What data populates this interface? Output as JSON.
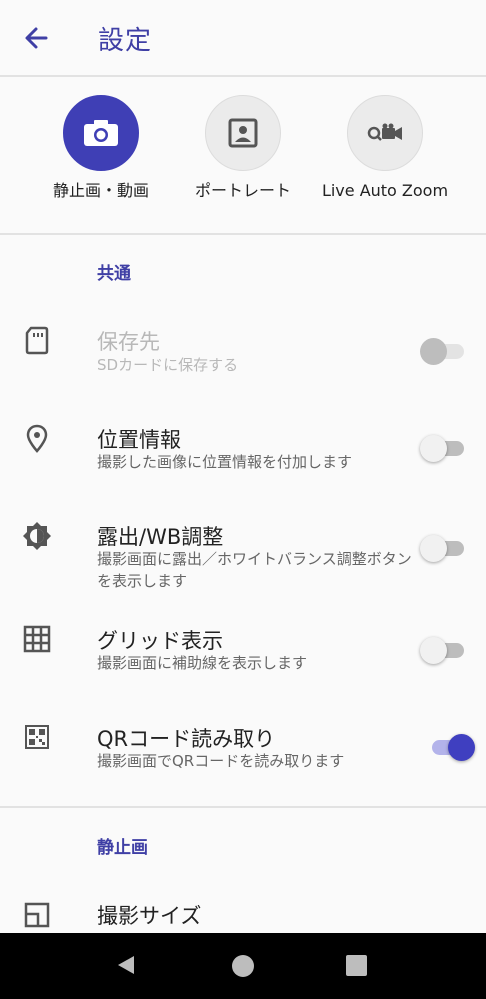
{
  "header": {
    "title": "設定"
  },
  "modes": [
    {
      "label": "静止画・動画",
      "icon": "camera-icon",
      "active": true
    },
    {
      "label": "ポートレート",
      "icon": "portrait-icon",
      "active": false
    },
    {
      "label": "Live Auto Zoom",
      "icon": "auto-zoom-icon",
      "active": false
    }
  ],
  "sections": {
    "common": "共通",
    "still": "静止画"
  },
  "settings": [
    {
      "title": "保存先",
      "subtitle": "SDカードに保存する",
      "icon": "sd-card-icon",
      "enabled": false,
      "on": false
    },
    {
      "title": "位置情報",
      "subtitle": "撮影した画像に位置情報を付加します",
      "icon": "location-pin-icon",
      "enabled": true,
      "on": false
    },
    {
      "title": "露出/WB調整",
      "subtitle": "撮影画面に露出／ホワイトバランス調整ボタンを表示します",
      "icon": "brightness-icon",
      "enabled": true,
      "on": false
    },
    {
      "title": "グリッド表示",
      "subtitle": "撮影画面に補助線を表示します",
      "icon": "grid-icon",
      "enabled": true,
      "on": false
    },
    {
      "title": "QRコード読み取り",
      "subtitle": "撮影画面でQRコードを読み取ります",
      "icon": "qr-code-icon",
      "enabled": true,
      "on": true
    },
    {
      "title": "撮影サイズ",
      "icon": "photo-size-icon"
    }
  ],
  "colors": {
    "accent": "#3f3fb5",
    "background": "#fafafa",
    "navbar": "#000000"
  }
}
